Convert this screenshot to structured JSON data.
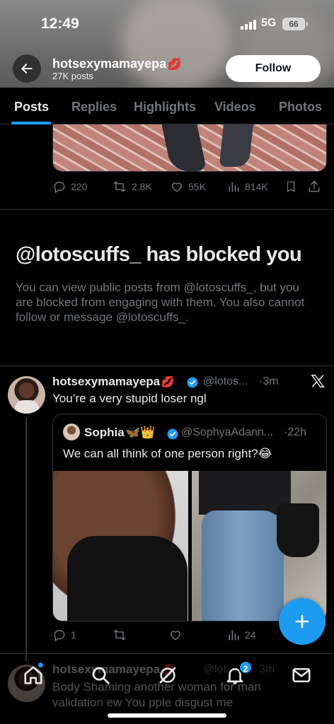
{
  "status_bar": {
    "time": "12:49",
    "network": "5G",
    "battery": "66"
  },
  "profile": {
    "name": "hotsexymamayepa",
    "post_count": "27K posts",
    "follow_label": "Follow"
  },
  "tabs": [
    {
      "label": "Posts",
      "active": true
    },
    {
      "label": "Replies",
      "active": false
    },
    {
      "label": "Highlights",
      "active": false
    },
    {
      "label": "Videos",
      "active": false
    },
    {
      "label": "Photos",
      "active": false
    }
  ],
  "post1": {
    "replies": "220",
    "reposts": "2.8K",
    "likes": "55K",
    "views": "814K"
  },
  "blocked": {
    "title": "@lotoscuffs_ has blocked you",
    "description": "You can view public posts from @lotoscuffs_, but you are blocked from engaging with them. You also cannot follow or message @lotoscuffs_."
  },
  "post2": {
    "name": "hotsexymamayepa",
    "handle": "@lotos...",
    "time": "·3m",
    "text": "You’re a very stupid loser ngl",
    "quote": {
      "name": "Sophia",
      "handle": "@SophyaAdann...",
      "time": "·22h",
      "text": "We can all think of one person right?😂"
    },
    "replies": "1",
    "reposts": "",
    "likes": "",
    "views": "24"
  },
  "post3": {
    "name": "hotsexymamayepa",
    "handle": "@lot",
    "time": "3m",
    "text": "Body Shaming another woman for man validation ew You pple disgust me"
  },
  "nav": {
    "notifications_count": "2"
  },
  "colors": {
    "accent": "#1d9bf0",
    "background": "#000000",
    "muted": "#71767b",
    "verified_badge": "#1d9bf0",
    "emoji_lips": "#e0245e"
  },
  "icons": [
    "back-arrow-icon",
    "reply-icon",
    "repost-icon",
    "like-icon",
    "views-icon",
    "bookmark-icon",
    "share-icon",
    "x-logo-icon",
    "verified-icon",
    "lips-emoji-icon",
    "butterfly-emoji-icon",
    "crown-emoji-icon",
    "compose-plus-icon",
    "home-icon",
    "search-icon",
    "grok-icon",
    "bell-icon",
    "mail-icon"
  ]
}
